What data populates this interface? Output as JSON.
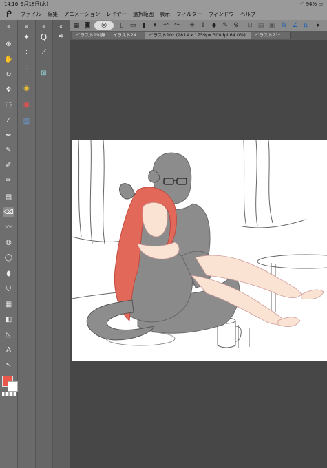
{
  "status": {
    "time": "14:16",
    "date": "9月18日(水)",
    "battery": "94%"
  },
  "menu": [
    "ファイル",
    "編集",
    "アニメーション",
    "レイヤー",
    "選択範囲",
    "表示",
    "フィルター",
    "ウィンドウ",
    "ヘルプ"
  ],
  "tabs": [
    {
      "label": "イラスト19(無"
    },
    {
      "label": "イラスト24"
    },
    {
      "label": "イラスト10* (2814 x 1759px 300dpi 64.0%)"
    },
    {
      "label": "イラスト21*"
    }
  ],
  "colors": {
    "main": "#e8574a",
    "sub": "#ffffff"
  }
}
